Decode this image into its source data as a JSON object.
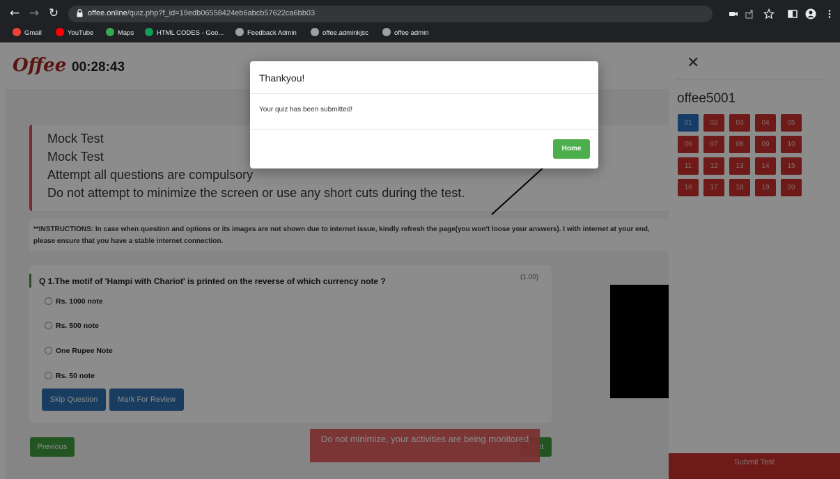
{
  "browser": {
    "url_host": "offee.online",
    "url_path": "/quiz.php?f_id=19edb06558424eb6abcb57622ca6bb03",
    "bookmarks": [
      {
        "label": "Gmail",
        "color": "#ea4335"
      },
      {
        "label": "YouTube",
        "color": "#ff0000"
      },
      {
        "label": "Maps",
        "color": "#34a853"
      },
      {
        "label": "HTML CODES - Goo...",
        "color": "#0f9d58"
      },
      {
        "label": "Feedback Admin",
        "color": "#9aa0a6"
      },
      {
        "label": "offee.adminkjsc",
        "color": "#9aa0a6"
      },
      {
        "label": "offee admin",
        "color": "#9aa0a6"
      }
    ]
  },
  "header": {
    "logo": "Offee",
    "timer": "00:28:43"
  },
  "notice": {
    "lines": [
      "Mock Test",
      "Mock Test",
      "Attempt all questions are compulsory",
      "Do not attempt to minimize the screen or use any short cuts during the test."
    ]
  },
  "instructions": "**INSTRUCTIONS: In case when question and options or its images are not shown due to internet issue, kindly refresh the page(you won't loose your answers). I with internet at your end, please ensure that you have a stable internet connection.",
  "question": {
    "text": "Q 1.The motif of 'Hampi with Chariot' is printed on the reverse of which currency note ?",
    "marks": "(1.00)",
    "options": [
      "Rs. 1000 note",
      "Rs. 500 note",
      "One Rupee Note",
      "Rs. 50 note"
    ],
    "skip_label": "Skip Question",
    "review_label": "Mark For Review"
  },
  "nav": {
    "previous_label": "Previous",
    "next_label": "Next"
  },
  "monitor_banner": "Do not minimize, your activities are being monitored",
  "sidepanel": {
    "close": "✕",
    "username": "offee5001",
    "question_numbers": [
      "01",
      "02",
      "03",
      "04",
      "05",
      "06",
      "07",
      "08",
      "09",
      "10",
      "11",
      "12",
      "13",
      "14",
      "15",
      "16",
      "17",
      "18",
      "19",
      "20"
    ],
    "active_index": 0,
    "submit_label": "Submit Test"
  },
  "modal": {
    "title": "Thankyou!",
    "body": "Your quiz has been submitted!",
    "home_label": "Home"
  },
  "colors": {
    "accent_red": "#c9302c",
    "accent_blue": "#2a6ebd",
    "accent_green": "#4cae4c"
  }
}
